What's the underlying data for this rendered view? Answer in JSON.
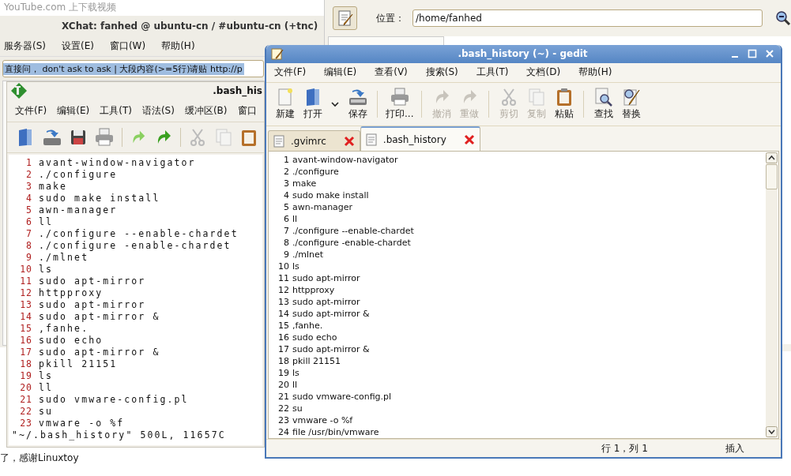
{
  "browser": {
    "heading": "YouTube.com 上下载视频",
    "footer_text": "了，感谢Linuxtoy"
  },
  "xchat": {
    "title": "XChat: fanhed @ ubuntu-cn / #ubuntu-cn (+tnc)",
    "menu": [
      "服务器(S)",
      "设置(E)",
      "窗口(W)",
      "帮助(H)"
    ],
    "topic": "直接问， don't ask to ask | 大段内容(>=5行)请贴 http://p"
  },
  "file_manager": {
    "location_label": "位置：",
    "location": "/home/fanhed"
  },
  "gvim": {
    "title": ".bash_his",
    "menu": [
      "文件(F)",
      "编辑(E)",
      "工具(T)",
      "语法(S)",
      "缓冲区(B)",
      "窗口"
    ],
    "lines": [
      {
        "n": "1",
        "text": "avant-window-navigator"
      },
      {
        "n": "2",
        "text": "./configure"
      },
      {
        "n": "3",
        "text": "make"
      },
      {
        "n": "4",
        "text": "sudo make install"
      },
      {
        "n": "5",
        "text": "awn-manager"
      },
      {
        "n": "6",
        "text": "ll"
      },
      {
        "n": "7",
        "text": "./configure --enable-chardet"
      },
      {
        "n": "8",
        "text": "./configure -enable-chardet"
      },
      {
        "n": "9",
        "text": "./mlnet"
      },
      {
        "n": "10",
        "text": "ls"
      },
      {
        "n": "11",
        "text": "sudo apt-mirror"
      },
      {
        "n": "12",
        "text": "httpproxy"
      },
      {
        "n": "13",
        "text": "sudo apt-mirror"
      },
      {
        "n": "14",
        "text": "sudo apt-mirror &"
      },
      {
        "n": "15",
        "text": ",fanhe."
      },
      {
        "n": "16",
        "text": "sudo echo"
      },
      {
        "n": "17",
        "text": "sudo apt-mirror &"
      },
      {
        "n": "18",
        "text": "pkill 21151"
      },
      {
        "n": "19",
        "text": "ls"
      },
      {
        "n": "20",
        "text": "ll"
      },
      {
        "n": "21",
        "text": "sudo vmware-config.pl"
      },
      {
        "n": "22",
        "text": "su"
      },
      {
        "n": "23",
        "text": "vmware -o %f"
      }
    ],
    "status": "\"~/.bash_history\" 500L, 11657C"
  },
  "gedit": {
    "title": ".bash_history (~) - gedit",
    "menu": [
      "文件(F)",
      "编辑(E)",
      "查看(V)",
      "搜索(S)",
      "工具(T)",
      "文档(D)",
      "帮助(H)"
    ],
    "toolbar": [
      {
        "kind": "button",
        "label": "新建",
        "disabled": false
      },
      {
        "kind": "button",
        "label": "打开",
        "disabled": false
      },
      {
        "kind": "dropdown"
      },
      {
        "kind": "button",
        "label": "保存",
        "disabled": false
      },
      {
        "kind": "separator"
      },
      {
        "kind": "button",
        "label": "打印...",
        "disabled": false
      },
      {
        "kind": "separator"
      },
      {
        "kind": "button",
        "label": "撤消",
        "disabled": true
      },
      {
        "kind": "button",
        "label": "重做",
        "disabled": true
      },
      {
        "kind": "separator"
      },
      {
        "kind": "button",
        "label": "剪切",
        "disabled": true
      },
      {
        "kind": "button",
        "label": "复制",
        "disabled": true
      },
      {
        "kind": "button",
        "label": "粘贴",
        "disabled": false
      },
      {
        "kind": "separator"
      },
      {
        "kind": "button",
        "label": "查找",
        "disabled": false
      },
      {
        "kind": "button",
        "label": "替换",
        "disabled": false
      }
    ],
    "tabs": [
      {
        "label": ".gvimrc",
        "selected": false
      },
      {
        "label": ".bash_history",
        "selected": true
      }
    ],
    "lines": [
      {
        "n": "1",
        "text": "avant-window-navigator"
      },
      {
        "n": "2",
        "text": "./configure"
      },
      {
        "n": "3",
        "text": "make"
      },
      {
        "n": "4",
        "text": "sudo make install"
      },
      {
        "n": "5",
        "text": "awn-manager"
      },
      {
        "n": "6",
        "text": "ll"
      },
      {
        "n": "7",
        "text": "./configure --enable-chardet"
      },
      {
        "n": "8",
        "text": "./configure -enable-chardet"
      },
      {
        "n": "9",
        "text": "./mlnet"
      },
      {
        "n": "10",
        "text": "ls"
      },
      {
        "n": "11",
        "text": "sudo apt-mirror"
      },
      {
        "n": "12",
        "text": "httpproxy"
      },
      {
        "n": "13",
        "text": "sudo apt-mirror"
      },
      {
        "n": "14",
        "text": "sudo apt-mirror &"
      },
      {
        "n": "15",
        "text": ",fanhe."
      },
      {
        "n": "16",
        "text": "sudo echo"
      },
      {
        "n": "17",
        "text": "sudo apt-mirror &"
      },
      {
        "n": "18",
        "text": "pkill 21151"
      },
      {
        "n": "19",
        "text": "ls"
      },
      {
        "n": "20",
        "text": "ll"
      },
      {
        "n": "21",
        "text": "sudo vmware-config.pl"
      },
      {
        "n": "22",
        "text": "su"
      },
      {
        "n": "23",
        "text": "vmware -o %f"
      },
      {
        "n": "24",
        "text": "file /usr/bin/vmware"
      }
    ],
    "status": {
      "position": "行 1，列 1",
      "mode": "插入"
    }
  }
}
